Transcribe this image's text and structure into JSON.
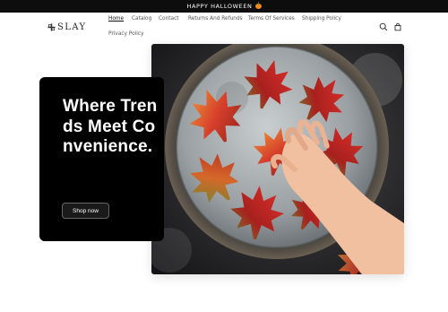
{
  "announcement": {
    "text": "HAPPY HALLOWEEN",
    "icon": "pumpkin-icon"
  },
  "header": {
    "logo_text": "SLAY",
    "nav": [
      {
        "label": "Home",
        "active": true
      },
      {
        "label": "Catalog"
      },
      {
        "label": "Contact"
      },
      {
        "label": "Returns And Refunds"
      },
      {
        "label": "Terms Of Services"
      },
      {
        "label": "Shipping Policy"
      },
      {
        "label": "Privacy Policy"
      }
    ],
    "icons": [
      "search-icon",
      "cart-icon"
    ]
  },
  "hero": {
    "heading": "Where Trends Meet Convenience.",
    "button_label": "Shop now",
    "image": "autumn-leaf-cookies-photo"
  },
  "colors": {
    "banner": "#0d0d0d",
    "card": "#000000",
    "pumpkin": "#f28a1b"
  }
}
